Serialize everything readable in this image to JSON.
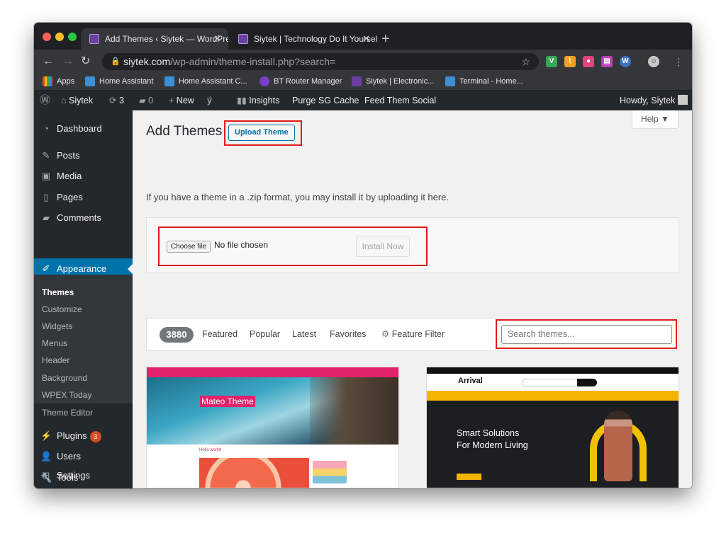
{
  "browser": {
    "tabs": [
      {
        "title": "Add Themes ‹ Siytek — WordPress",
        "active": true
      },
      {
        "title": "Siytek | Technology Do It Yourself",
        "active": false
      }
    ],
    "url_host": "siytek.com",
    "url_path": "/wp-admin/theme-install.php?search=",
    "bookmarks": [
      "Apps",
      "Home Assistant",
      "Home Assistant C...",
      "BT Router Manager",
      "Siytek | Electronic...",
      "Terminal - Home..."
    ]
  },
  "adminbar": {
    "site": "Siytek",
    "updates": "3",
    "comments": "0",
    "new": "New",
    "insights": "Insights",
    "purge": "Purge SG Cache",
    "feed": "Feed Them Social",
    "howdy": "Howdy, Siytek"
  },
  "sidebar": {
    "items": [
      {
        "label": "Dashboard",
        "icon": "dashboard-icon"
      },
      {
        "label": "Posts",
        "icon": "pin-icon"
      },
      {
        "label": "Media",
        "icon": "media-icon"
      },
      {
        "label": "Pages",
        "icon": "pages-icon"
      },
      {
        "label": "Comments",
        "icon": "comment-icon"
      },
      {
        "label": "Appearance",
        "icon": "paintbrush-icon"
      }
    ],
    "submenu": [
      "Themes",
      "Customize",
      "Widgets",
      "Menus",
      "Header",
      "Background",
      "WPEX Today",
      "Theme Editor"
    ],
    "lower": [
      {
        "label": "Plugins",
        "icon": "plugin-icon",
        "badge": "3"
      },
      {
        "label": "Users",
        "icon": "user-icon"
      },
      {
        "label": "Tools",
        "icon": "wrench-icon"
      },
      {
        "label": "Settings",
        "icon": "settings-icon"
      }
    ]
  },
  "main": {
    "title": "Add Themes",
    "upload_button": "Upload Theme",
    "help": "Help ▼",
    "description": "If you have a theme in a .zip format, you may install it by uploading it here.",
    "choose_file": "Choose file",
    "no_file": "No file chosen",
    "install_now": "Install Now",
    "count": "3880",
    "filters": [
      "Featured",
      "Popular",
      "Latest",
      "Favorites"
    ],
    "feature_filter": "Feature Filter",
    "search_placeholder": "Search themes..."
  },
  "themes": {
    "mateo_label": "Mateo Theme",
    "mateo_post": "Hello world!",
    "arrival_logo": "Arrival",
    "arrival_headline_1": "Smart Solutions",
    "arrival_headline_2": "For Modern Living"
  },
  "colors": {
    "wp_blue": "#0073aa",
    "highlight_red": "#e21b1b",
    "admin_dark": "#23282d"
  }
}
